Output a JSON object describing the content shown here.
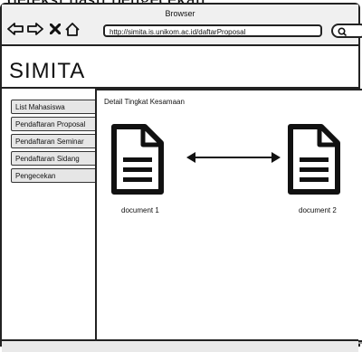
{
  "caption": "deteksi hasil pengecekan",
  "browser": {
    "title": "Browser",
    "url": "http://simita.is.unikom.ac.id/daftarProposal"
  },
  "app": {
    "title": "SIMITA"
  },
  "sidebar": {
    "items": [
      {
        "label": "List Mahasiswa"
      },
      {
        "label": "Pendaftaran Proposal"
      },
      {
        "label": "Pendaftaran Seminar"
      },
      {
        "label": "Pendaftaran Sidang"
      },
      {
        "label": "Pengecekan"
      }
    ]
  },
  "panel": {
    "title": "Detail Tingkat Kesamaan",
    "doc1_label": "document 1",
    "doc2_label": "document 2"
  },
  "icons": {
    "back": "back-arrow-icon",
    "forward": "forward-arrow-icon",
    "stop": "close-icon",
    "home": "home-icon",
    "search": "search-icon",
    "document": "document-icon",
    "compare": "double-arrow-icon"
  }
}
